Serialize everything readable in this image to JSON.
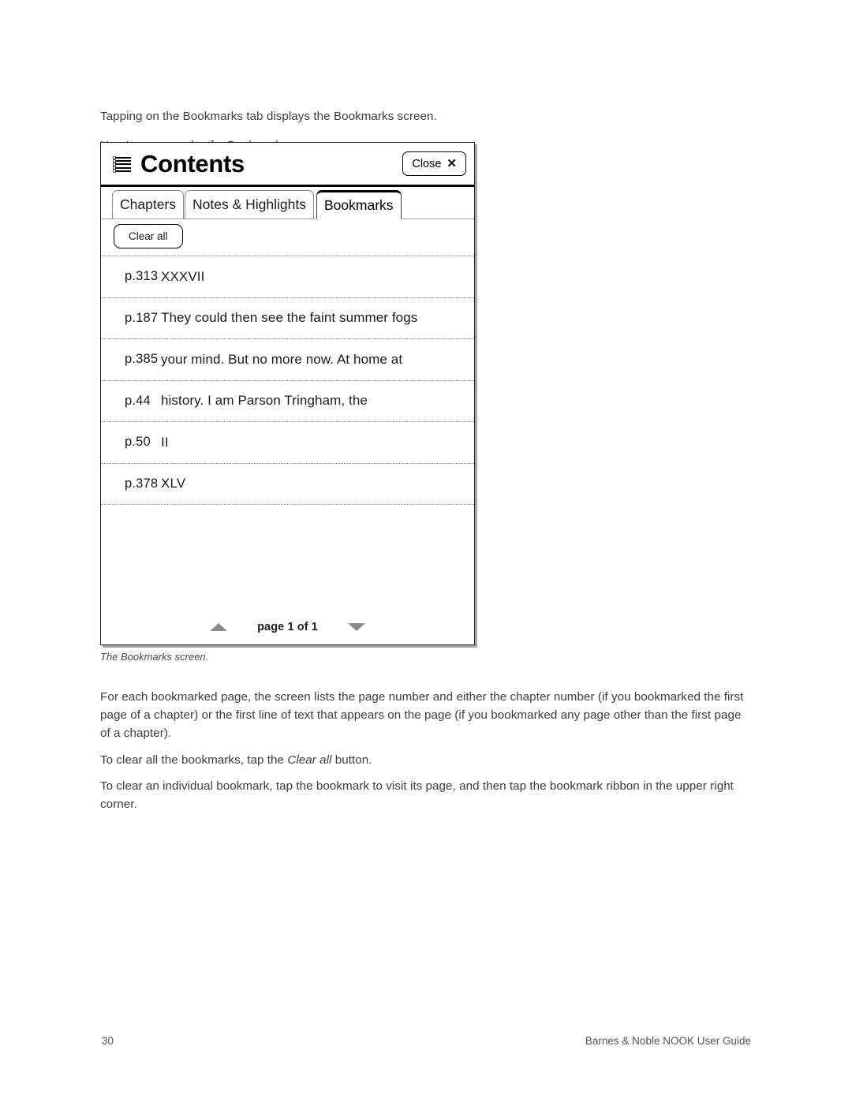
{
  "document": {
    "intro_line_1": "Tapping on the Bookmarks tab displays the Bookmarks screen.",
    "intro_line_2": "Here's an example of a Bookmarks screen.",
    "caption": "The Bookmarks screen.",
    "paragraph_1": "For each bookmarked page, the screen lists the page number and either the chapter number (if you bookmarked the first page of a chapter) or the first line of text that appears on the page (if you bookmarked any page other than the first page of a chapter).",
    "paragraph_2_before": "To clear all the bookmarks, tap the ",
    "paragraph_2_italic": "Clear all",
    "paragraph_2_after": " button.",
    "paragraph_3": "To clear an individual bookmark, tap the bookmark to visit its page, and then tap the bookmark ribbon in the upper right corner.",
    "footer_page_number": "30",
    "footer_title": "Barnes & Noble NOOK User Guide"
  },
  "figure": {
    "header": {
      "title": "Contents",
      "menu_icon": "list-lines-icon",
      "close_label": "Close",
      "close_icon": "close-x-icon"
    },
    "tabs": [
      {
        "label": "Chapters",
        "active": false
      },
      {
        "label": "Notes & Highlights",
        "active": false
      },
      {
        "label": "Bookmarks",
        "active": true
      }
    ],
    "toolbar": {
      "clear_all_label": "Clear all"
    },
    "bookmarks": [
      {
        "page": "p.313",
        "text": "XXXVII"
      },
      {
        "page": "p.187",
        "text": "They could then see the faint summer fogs"
      },
      {
        "page": "p.385",
        "text": "your mind. But no more now. At home at"
      },
      {
        "page": "p.44",
        "text": "history. I am Parson Tringham, the"
      },
      {
        "page": "p.50",
        "text": "II"
      },
      {
        "page": "p.378",
        "text": "XLV"
      }
    ],
    "pager": {
      "up_icon": "triangle-up-icon",
      "label": "page 1 of 1",
      "down_icon": "triangle-down-icon"
    }
  },
  "colors": {
    "body_text": "#3d3d3d",
    "frame_border": "#231f20",
    "divider": "#8d8d8d",
    "pager_arrow": "#8a8a8a"
  }
}
